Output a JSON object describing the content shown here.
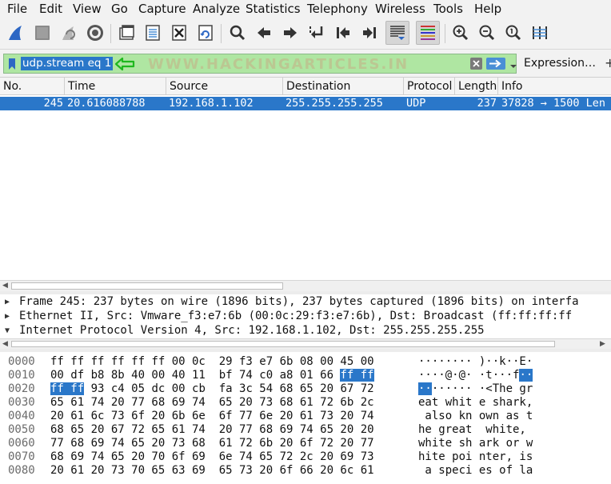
{
  "menu": [
    "File",
    "Edit",
    "View",
    "Go",
    "Capture",
    "Analyze",
    "Statistics",
    "Telephony",
    "Wireless",
    "Tools",
    "Help"
  ],
  "toolbar": {
    "icons": [
      "shark-fin-start-icon",
      "stop-capture-icon",
      "restart-capture-icon",
      "capture-options-icon",
      "open-file-icon",
      "save-file-icon",
      "close-file-icon",
      "reload-file-icon",
      "find-packet-icon",
      "go-back-icon",
      "go-forward-icon",
      "go-to-packet-icon",
      "first-packet-icon",
      "last-packet-icon",
      "autoscroll-icon",
      "colorize-icon",
      "zoom-in-icon",
      "zoom-out-icon",
      "normal-size-icon",
      "resize-columns-icon"
    ]
  },
  "filter": {
    "value": "udp.stream eq 1",
    "watermark": "WWW.HACKINGARTICLES.IN",
    "expression_label": "Expression…",
    "add_label": "+",
    "bg_color": "#afe6a2"
  },
  "packet_list": {
    "columns": [
      "No.",
      "Time",
      "Source",
      "Destination",
      "Protocol",
      "Length",
      "Info"
    ],
    "rows": [
      {
        "no": "245",
        "time": "20.616088788",
        "source": "192.168.1.102",
        "destination": "255.255.255.255",
        "protocol": "UDP",
        "length": "237",
        "info": "37828 → 1500 Len"
      }
    ]
  },
  "details": [
    {
      "expanded": false,
      "text": "Frame 245: 237 bytes on wire (1896 bits), 237 bytes captured (1896 bits) on interfa"
    },
    {
      "expanded": false,
      "text": "Ethernet II, Src: Vmware_f3:e7:6b (00:0c:29:f3:e7:6b), Dst: Broadcast (ff:ff:ff:ff"
    },
    {
      "expanded": true,
      "text": "Internet Protocol Version 4, Src: 192.168.1.102, Dst: 255.255.255.255"
    }
  ],
  "bytes": [
    {
      "offset": "0000",
      "hex": [
        "ff ff ff ff ff ff 00 0c  29 f3 e7 6b 08 00 45 00"
      ],
      "ascii": [
        "········ )··k··E·"
      ]
    },
    {
      "offset": "0010",
      "hex": [
        "00 df b8 8b 40 00 40 11  bf 74 c0 a8 01 66 ",
        "ff ff"
      ],
      "ascii": [
        "····@·@· ·t···f",
        "··"
      ]
    },
    {
      "offset": "0020",
      "hex": [
        "",
        "ff ff",
        " 93 c4 05 dc 00 cb  fa 3c 54 68 65 20 67 72"
      ],
      "ascii": [
        "",
        "··",
        "······ ·<The gr"
      ]
    },
    {
      "offset": "0030",
      "hex": [
        "65 61 74 20 77 68 69 74  65 20 73 68 61 72 6b 2c"
      ],
      "ascii": [
        "eat whit e shark,"
      ]
    },
    {
      "offset": "0040",
      "hex": [
        "20 61 6c 73 6f 20 6b 6e  6f 77 6e 20 61 73 20 74"
      ],
      "ascii": [
        " also kn own as t"
      ]
    },
    {
      "offset": "0050",
      "hex": [
        "68 65 20 67 72 65 61 74  20 77 68 69 74 65 20 20"
      ],
      "ascii": [
        "he great  white, "
      ]
    },
    {
      "offset": "0060",
      "hex": [
        "77 68 69 74 65 20 73 68  61 72 6b 20 6f 72 20 77"
      ],
      "ascii": [
        "white sh ark or w"
      ]
    },
    {
      "offset": "0070",
      "hex": [
        "68 69 74 65 20 70 6f 69  6e 74 65 72 2c 20 69 73"
      ],
      "ascii": [
        "hite poi nter, is"
      ]
    },
    {
      "offset": "0080",
      "hex": [
        "20 61 20 73 70 65 63 69  65 73 20 6f 66 20 6c 61"
      ],
      "ascii": [
        " a speci es of la"
      ]
    }
  ],
  "colors": {
    "selection": "#2a77c9",
    "filter_valid": "#afe6a2"
  }
}
